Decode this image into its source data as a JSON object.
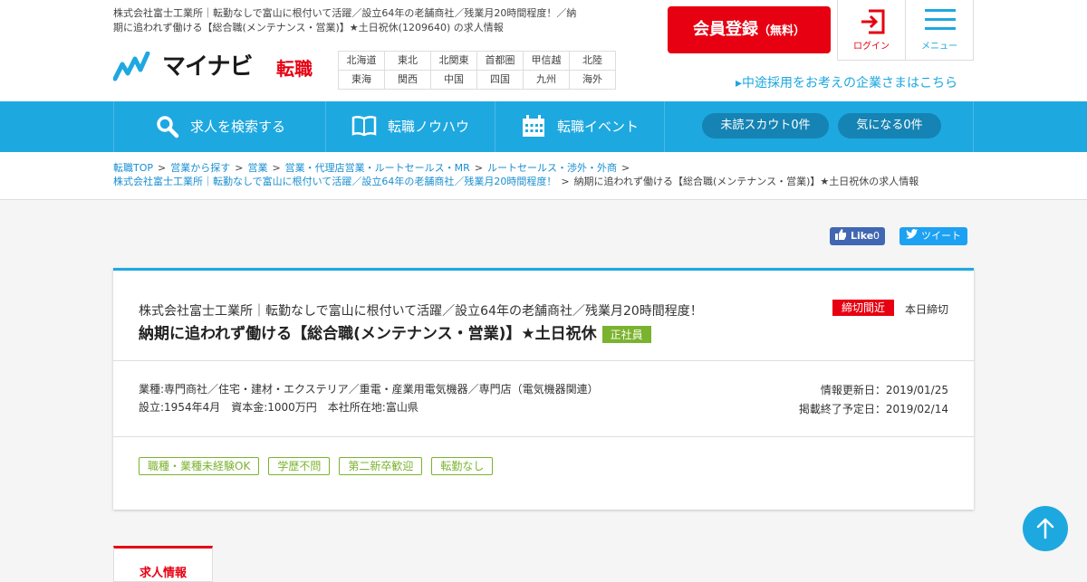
{
  "header": {
    "description": "株式会社富士工業所｜転勤なしで富山に根付いて活躍／設立64年の老舗商社／残業月20時間程度！／納期に追われず働ける【総合職(メンテナンス・営業)】★土日祝休(1209640) の求人情報",
    "logo_text": "マイナビ",
    "logo_sub": "転職",
    "regions": [
      [
        "北海道",
        "東北",
        "北関東",
        "首都圏",
        "甲信越",
        "北陸"
      ],
      [
        "東海",
        "関西",
        "中国",
        "四国",
        "九州",
        "海外"
      ]
    ],
    "register_label": "会員登録",
    "register_sub": "（無料）",
    "login_label": "ログイン",
    "menu_label": "メニュー",
    "corp_link": "▸中途採用をお考えの企業さまはこちら"
  },
  "nav": {
    "search": "求人を検索する",
    "knowhow": "転職ノウハウ",
    "event": "転職イベント",
    "scout": "未読スカウト0件",
    "favorite": "気になる0件"
  },
  "breadcrumb": {
    "items": [
      "転職TOP",
      "営業から探す",
      "営業",
      "営業・代理店営業・ルートセールス・MR",
      "ルートセールス・渉外・外商"
    ],
    "company_link": "株式会社富士工業所｜転勤なしで富山に根付いて活躍／設立64年の老舗商社／残業月20時間程度！",
    "current": "納期に追われず働ける【総合職(メンテナンス・営業)】★土日祝休の求人情報",
    "sep": ">"
  },
  "social": {
    "like": "Like",
    "like_count": "0",
    "tweet": "ツイート"
  },
  "job": {
    "company": "株式会社富士工業所｜転勤なしで富山に根付いて活躍／設立64年の老舗商社／残業月20時間程度！",
    "title": "納期に追われず働ける【総合職(メンテナンス・営業)】★土日祝休",
    "employment": "正社員",
    "deadline_badge": "締切間近",
    "deadline_text": "本日締切",
    "industry": "業種:専門商社／住宅・建材・エクステリア／重電・産業用電気機器／専門店（電気機器関連）",
    "established": "設立:1954年4月　資本金:1000万円　本社所在地:富山県",
    "updated": "情報更新日：2019/01/25",
    "end_date": "掲載終了予定日：2019/02/14",
    "tags": [
      "職種・業種未経験OK",
      "学歴不問",
      "第二新卒歓迎",
      "転勤なし"
    ]
  },
  "tab": {
    "label": "求人情報"
  },
  "colors": {
    "accent": "#1ea8e0",
    "brand_red": "#e60012",
    "tag_green": "#7ab32e"
  }
}
